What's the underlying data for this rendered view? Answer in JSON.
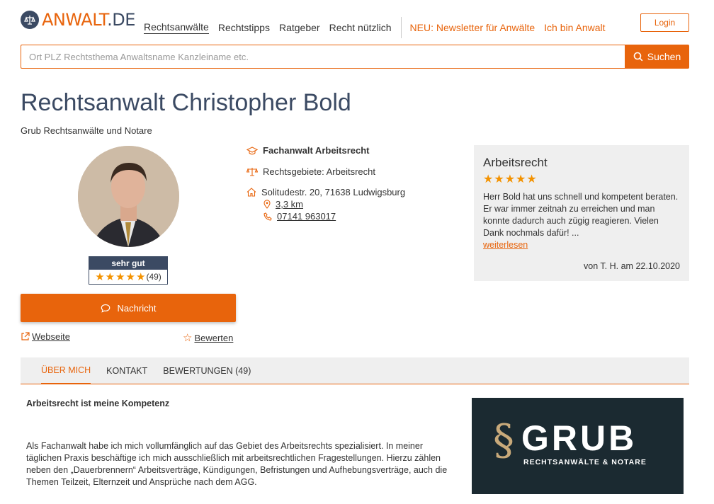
{
  "header": {
    "logo_prefix": "ANWALT",
    "logo_suffix": ".DE",
    "nav": [
      {
        "label": "Rechtsanwälte"
      },
      {
        "label": "Rechtstipps"
      },
      {
        "label": "Ratgeber"
      },
      {
        "label": "Recht nützlich"
      }
    ],
    "promo": [
      {
        "label": "NEU: Newsletter für Anwälte"
      },
      {
        "label": "Ich bin Anwalt"
      }
    ],
    "login_label": "Login"
  },
  "search": {
    "placeholder": "Ort PLZ Rechtsthema Anwaltsname Kanzleiname etc.",
    "button_label": "Suchen"
  },
  "profile": {
    "title": "Rechtsanwalt Christopher Bold",
    "firm": "Grub Rechtsanwälte und Notare",
    "rating_label": "sehr gut",
    "rating_count": "(49)",
    "rating_stars": 5,
    "message_label": "Nachricht",
    "website_label": "Webseite",
    "rate_label": "Bewerten"
  },
  "info": {
    "specialist": "Fachanwalt Arbeitsrecht",
    "areas": "Rechtsgebiete: Arbeitsrecht",
    "address": "Solitudestr. 20, 71638 Ludwigsburg",
    "distance": "3,3 km",
    "phone": "07141 963017"
  },
  "review": {
    "title": "Arbeitsrecht",
    "stars": 5,
    "text": "Herr Bold hat uns schnell und kompetent beraten. Er war immer zeitnah zu erreichen und man konnte dadurch auch zügig reagieren. Vielen Dank nochmals dafür! ...",
    "more_label": "weiterlesen",
    "author": "von T. H. am 22.10.2020"
  },
  "tabs": [
    {
      "label": "ÜBER MICH"
    },
    {
      "label": "KONTAKT"
    },
    {
      "label": "BEWERTUNGEN (49)"
    }
  ],
  "about": {
    "heading": "Arbeitsrecht ist meine Kompetenz",
    "text": "Als Fachanwalt habe ich mich vollumfänglich auf das Gebiet des Arbeitsrechts spezialisiert. In meiner täglichen Praxis beschäftige ich mich ausschließlich mit arbeitsrechtlichen Fragestellungen. Hierzu zählen neben den „Dauerbrennern“ Arbeitsverträge, Kündigungen, Befristungen und Aufhebungsverträge, auch die Themen Teilzeit, Elternzeit und Ansprüche nach dem AGG."
  },
  "firm_logo": {
    "symbol": "§",
    "name": "GRUB",
    "tagline": "RECHTSANWÄLTE & NOTARE"
  },
  "colors": {
    "accent": "#e8640c",
    "navy": "#3b4a63",
    "star": "#f39200"
  }
}
